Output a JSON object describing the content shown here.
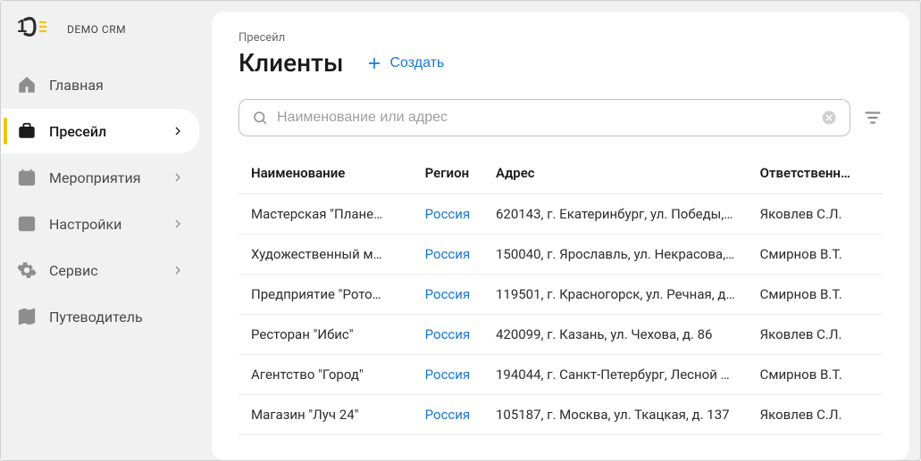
{
  "brand": {
    "logo_text": "1C",
    "name": "DEMO CRM"
  },
  "sidebar": {
    "items": [
      {
        "label": "Главная",
        "icon": "home",
        "expandable": false,
        "active": false
      },
      {
        "label": "Пресейл",
        "icon": "briefcase",
        "expandable": true,
        "active": true
      },
      {
        "label": "Мероприятия",
        "icon": "calendar",
        "expandable": true,
        "active": false
      },
      {
        "label": "Настройки",
        "icon": "edit",
        "expandable": true,
        "active": false
      },
      {
        "label": "Сервис",
        "icon": "gear",
        "expandable": true,
        "active": false
      },
      {
        "label": "Путеводитель",
        "icon": "map",
        "expandable": false,
        "active": false
      }
    ]
  },
  "breadcrumb": "Пресейл",
  "page_title": "Клиенты",
  "create_label": "Создать",
  "search": {
    "placeholder": "Наименование или адрес"
  },
  "table": {
    "headers": {
      "name": "Наименование",
      "region": "Регион",
      "address": "Адрес",
      "responsible": "Ответственн…"
    },
    "rows": [
      {
        "name": "Мастерская \"Плане…",
        "region": "Россия",
        "address": "620143, г. Екатеринбург, ул. Победы, …",
        "responsible": "Яковлев С.Л."
      },
      {
        "name": "Художественный м…",
        "region": "Россия",
        "address": "150040, г. Ярославль, ул. Некрасова,…",
        "responsible": "Смирнов В.Т."
      },
      {
        "name": "Предприятие \"Рото…",
        "region": "Россия",
        "address": "119501, г. Красногорск, ул. Речная, д…",
        "responsible": "Смирнов В.Т."
      },
      {
        "name": "Ресторан \"Ибис\"",
        "region": "Россия",
        "address": "420099, г. Казань, ул. Чехова, д. 86",
        "responsible": "Яковлев С.Л."
      },
      {
        "name": "Агентство \"Город\"",
        "region": "Россия",
        "address": "194044, г. Санкт-Петербург, Лесной …",
        "responsible": "Смирнов В.Т."
      },
      {
        "name": "Магазин \"Луч 24\"",
        "region": "Россия",
        "address": "105187, г. Москва, ул. Ткацкая, д. 137",
        "responsible": "Яковлев С.Л."
      }
    ]
  }
}
